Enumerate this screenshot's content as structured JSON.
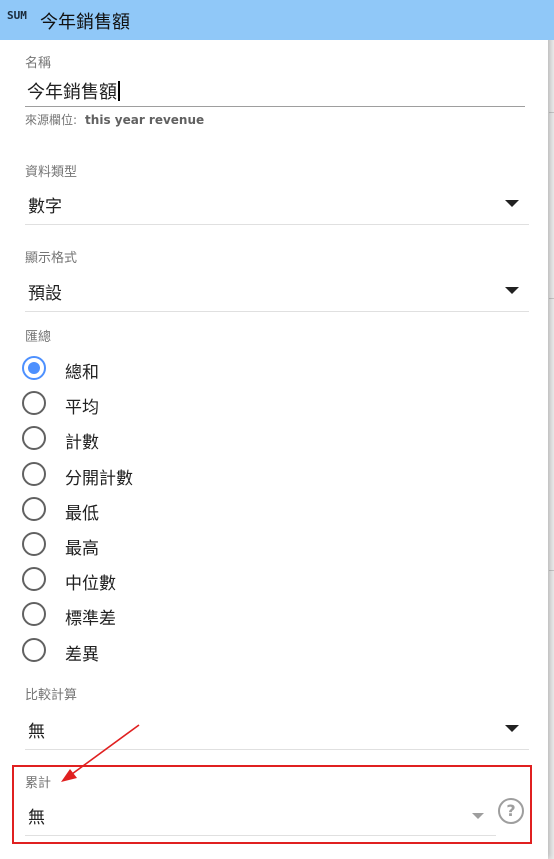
{
  "header": {
    "badge": "SUM",
    "title": "今年銷售額"
  },
  "name": {
    "label": "名稱",
    "value": "今年銷售額",
    "source_label": "來源欄位:",
    "source_value": "this year revenue"
  },
  "data_type": {
    "label": "資料類型",
    "value": "數字"
  },
  "display_format": {
    "label": "顯示格式",
    "value": "預設"
  },
  "aggregation": {
    "label": "匯總",
    "selected": "總和",
    "options": [
      "總和",
      "平均",
      "計數",
      "分開計數",
      "最低",
      "最高",
      "中位數",
      "標準差",
      "差異"
    ]
  },
  "comparison": {
    "label": "比較計算",
    "value": "無"
  },
  "running": {
    "label": "累計",
    "value": "無",
    "help_glyph": "?"
  },
  "colors": {
    "header": "#90c8f8",
    "accent": "#4d90fe",
    "highlight": "#e02020"
  }
}
